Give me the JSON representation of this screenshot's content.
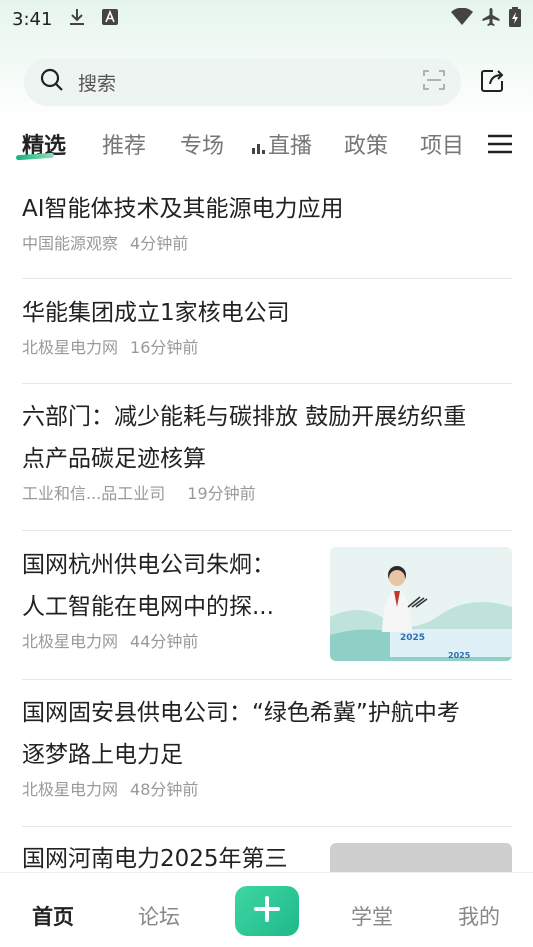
{
  "status_bar": {
    "time": "3:41",
    "icons": [
      "download-icon",
      "a-notification-icon",
      "wifi-icon",
      "airplane-icon",
      "battery-icon"
    ]
  },
  "search": {
    "placeholder": "搜索",
    "icons": [
      "search-icon",
      "scan-icon",
      "share-icon"
    ]
  },
  "tabs": [
    {
      "label": "精选",
      "active": true
    },
    {
      "label": "推荐"
    },
    {
      "label": "专场"
    },
    {
      "label": "直播"
    },
    {
      "label": "政策"
    },
    {
      "label": "项目"
    }
  ],
  "feed": [
    {
      "title": "AI智能体技术及其能源电力应用",
      "source": "中国能源观察",
      "time": "4分钟前"
    },
    {
      "title": "华能集团成立1家核电公司",
      "source": "北极星电力网",
      "time": "16分钟前"
    },
    {
      "title_line1": "六部门：减少能耗与碳排放 鼓励开展纺织重",
      "title_line2": "点产品碳足迹核算",
      "source": "工业和信...品工业司",
      "time": "19分钟前"
    },
    {
      "title_line1": "国网杭州供电公司朱炯：",
      "title_line2": "人工智能在电网中的探...",
      "source": "北极星电力网",
      "time": "44分钟前",
      "thumb_text_1": "2025",
      "thumb_text_2": "2025"
    },
    {
      "title_line1": "国网固安县供电公司：“绿色希冀”护航中考",
      "title_line2": "逐梦路上电力足",
      "source": "北极星电力网",
      "time": "48分钟前"
    },
    {
      "title": "国网河南电力2025年第三"
    }
  ],
  "bottom_nav": {
    "home": "首页",
    "forum": "论坛",
    "add": "+",
    "academy": "学堂",
    "mine": "我的"
  },
  "colors": {
    "accent": "#1fb98a",
    "tab_inactive": "#777777",
    "meta": "#999999"
  }
}
